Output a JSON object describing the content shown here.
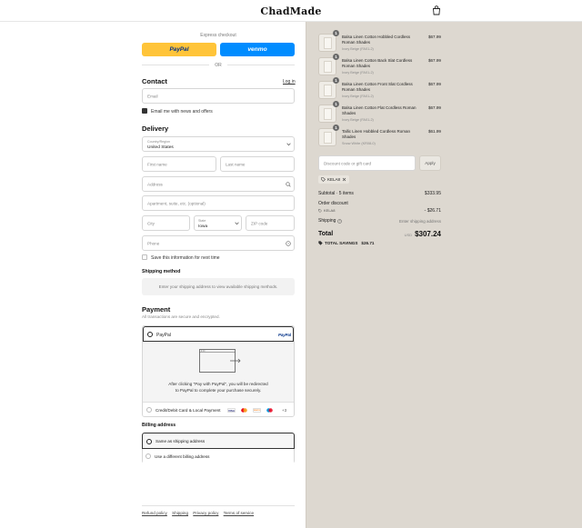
{
  "header": {
    "logo": "ChadMade",
    "cart_icon": "shopping-bag-icon"
  },
  "express": {
    "label": "Express checkout",
    "paypal_label": "PayPal",
    "venmo_label": "venmo",
    "or_label": "OR"
  },
  "contact": {
    "title": "Contact",
    "login_label": "Log in",
    "email_placeholder": "Email",
    "newsletter_label": "Email me with news and offers",
    "newsletter_checked": true
  },
  "delivery": {
    "title": "Delivery",
    "country_label": "Country/Region",
    "country_value": "United States",
    "first_name": "First name",
    "last_name": "Last name",
    "address": "Address",
    "apartment": "Apartment, suite, etc. (optional)",
    "city": "City",
    "state_label": "State",
    "state_value": "Iowa",
    "zip": "ZIP code",
    "phone": "Phone",
    "save_info_label": "Save this information for next time"
  },
  "shipping_method": {
    "title": "Shipping method",
    "message": "Enter your shipping address to view available shipping methods."
  },
  "payment": {
    "title": "Payment",
    "subtitle": "All transactions are secure and encrypted.",
    "paypal_option": "PayPal",
    "paypal_logo": "PayPal",
    "redirect_text_1": "After clicking \"Pay with PayPal\", you will be redirected",
    "redirect_text_2": "to PayPal to complete your purchase securely.",
    "card_option": "Credit/Debit Card & Local Payment",
    "card_more": "+3",
    "card_brands": [
      "VISA",
      "mastercard",
      "DISCOVER",
      "maestro"
    ]
  },
  "billing": {
    "title": "Billing address",
    "same_option": "Same as shipping address",
    "different_option": "Use a different billing address"
  },
  "footer": {
    "links": [
      "Refund policy",
      "Shipping",
      "Privacy policy",
      "Terms of service"
    ]
  },
  "order": {
    "items": [
      {
        "qty": "1",
        "name": "Balsa Linen Cotton Hobbled Cordless Roman Shades",
        "variant": "Ivory Beige (FA01-2)",
        "price": "$67.99"
      },
      {
        "qty": "1",
        "name": "Balsa Linen Cotton Back Slat Cordless Roman Shades",
        "variant": "Ivory Beige (FA01-2)",
        "price": "$67.99"
      },
      {
        "qty": "1",
        "name": "Balsa Linen Cotton Front Slat Cordless Roman Shades",
        "variant": "Ivory Beige (FA01-2)",
        "price": "$67.99"
      },
      {
        "qty": "1",
        "name": "Balsa Linen Cotton Flat Cordless Roman Shades",
        "variant": "Ivory Beige (FA01-2)",
        "price": "$67.99"
      },
      {
        "qty": "1",
        "name": "Tallic Linen Hobbled Cordless Roman Shades",
        "variant": "Snow White (KR08-0)",
        "price": "$61.99"
      }
    ],
    "discount_placeholder": "Discount code or gift card",
    "apply_label": "Apply",
    "code_tag": "KELA8",
    "subtotal_label": "Subtotal · 5 items",
    "subtotal_value": "$333.95",
    "order_discount_label": "Order discount",
    "discount_code": "KELA8",
    "discount_value": "- $26.71",
    "shipping_label": "Shipping",
    "shipping_value": "Enter shipping address",
    "total_label": "Total",
    "currency": "USD",
    "total_value": "$307.24",
    "savings_label": "TOTAL SAVINGS",
    "savings_value": "$26.71"
  },
  "colors": {
    "paypal_yellow": "#ffc439",
    "venmo_blue": "#008cff",
    "right_bg": "#ddd8d0"
  }
}
